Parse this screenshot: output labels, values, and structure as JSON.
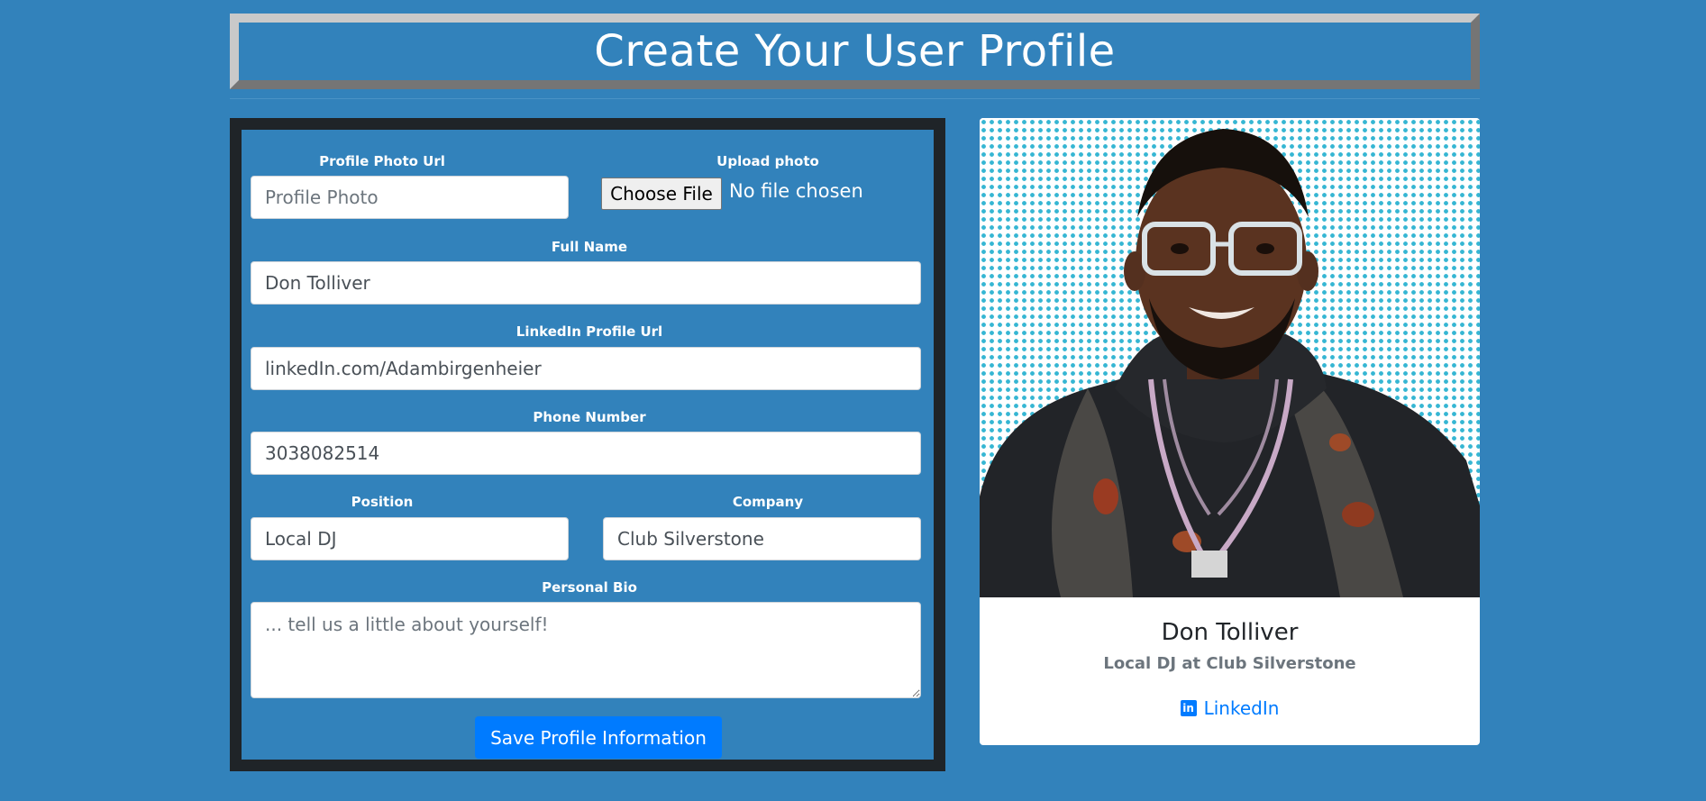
{
  "header": {
    "title": "Create Your User Profile"
  },
  "form": {
    "photo_url": {
      "label": "Profile Photo Url",
      "placeholder": "Profile Photo",
      "value": ""
    },
    "upload": {
      "label": "Upload photo",
      "button": "Choose File",
      "status": "No file chosen"
    },
    "full_name": {
      "label": "Full Name",
      "value": "Don Tolliver"
    },
    "linkedin": {
      "label": "LinkedIn Profile Url",
      "value": "linkedIn.com/Adambirgenheier"
    },
    "phone": {
      "label": "Phone Number",
      "value": "3038082514"
    },
    "position": {
      "label": "Position",
      "value": "Local DJ"
    },
    "company": {
      "label": "Company",
      "value": "Club Silverstone"
    },
    "bio": {
      "label": "Personal Bio",
      "placeholder": "... tell us a little about yourself!"
    },
    "save_label": "Save Profile Information"
  },
  "card": {
    "name": "Don Tolliver",
    "subtitle": "Local DJ at Club Silverstone",
    "link_label": "LinkedIn",
    "link_icon": "linkedin-icon"
  },
  "colors": {
    "background": "#3282bb",
    "panel_border": "#1f2428",
    "primary": "#007bff",
    "photo_dots": "#36b6d3"
  }
}
